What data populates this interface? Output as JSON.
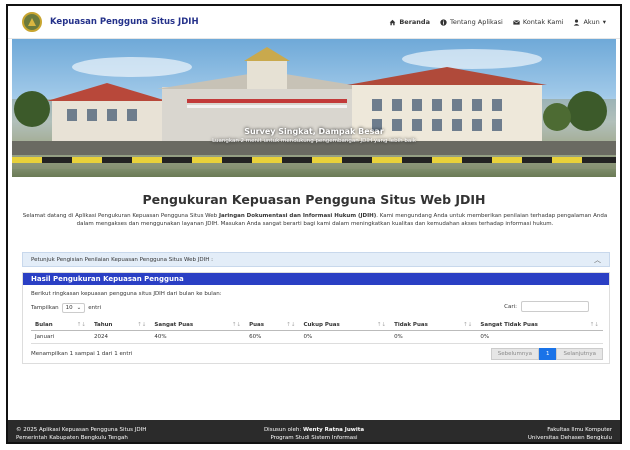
{
  "nav": {
    "brand": "Kepuasan Pengguna Situs JDIH",
    "items": [
      {
        "label": "Beranda",
        "icon": "home-icon"
      },
      {
        "label": "Tentang Aplikasi",
        "icon": "info-icon"
      },
      {
        "label": "Kontak Kami",
        "icon": "envelope-icon"
      },
      {
        "label": "Akun",
        "icon": "user-icon"
      }
    ]
  },
  "hero": {
    "tagline": "Survey Singkat, Dampak Besar",
    "subtitle": "Luangkan 2 menit untuk mendukung pengembangan JDIH yang lebih baik"
  },
  "main": {
    "title": "Pengukuran Kepuasan Pengguna Situs Web JDIH",
    "intro_prefix": "Selamat datang di Aplikasi Pengukuran Kepuasan Pengguna Situs Web ",
    "intro_bold": "Jaringan Dokumentasi dan Informasi Hukum (JDIH)",
    "intro_suffix": ". Kami mengundang Anda untuk memberikan penilaian terhadap pengalaman Anda dalam mengakses dan menggunakan layanan JDIH. Masukan Anda sangat berarti bagi kami dalam meningkatkan kualitas dan kemudahan akses terhadap informasi hukum.",
    "accordion": "Petunjuk Pengisian Penilaian Kepuasan Pengguna Situs Web JDIH :"
  },
  "results": {
    "heading": "Hasil Pengukuran Kepuasan Pengguna",
    "description": "Berikut ringkasan kepuasan pengguna situs JDIH dari bulan ke bulan:",
    "show_label": "Tampilkan",
    "show_value": "10",
    "show_suffix": "entri",
    "search_label": "Cari:",
    "columns": [
      "Bulan",
      "Tahun",
      "Sangat Puas",
      "Puas",
      "Cukup Puas",
      "Tidak Puas",
      "Sangat Tidak Puas"
    ],
    "rows": [
      [
        "Januari",
        "2024",
        "40%",
        "60%",
        "0%",
        "0%",
        "0%"
      ]
    ],
    "info": "Menampilkan 1 sampai 1 dari 1 entri",
    "prev": "Sebelumnya",
    "page": "1",
    "next": "Selanjutnya"
  },
  "footer": {
    "left1": "© 2025 Aplikasi Kepuasan Pengguna Situs JDIH",
    "left2": "Pemerintah Kabupaten Bengkulu Tengah",
    "mid1_prefix": "Disusun oleh: ",
    "mid1_name": "Wenty Ratna Juwita",
    "mid2": "Program Studi Sistem Informasi",
    "right1": "Fakultas Ilmu Komputer",
    "right2": "Universitas Dehasen Bengkulu"
  },
  "colors": {
    "brand": "#24318a",
    "card_header": "#2a3fc4",
    "accent": "#1a73e8",
    "footer": "#2b2b2b"
  }
}
